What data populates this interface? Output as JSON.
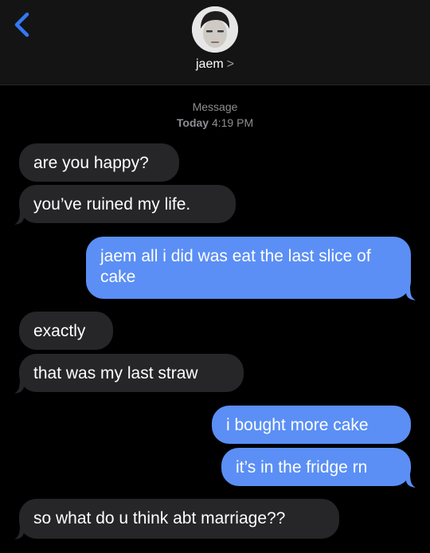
{
  "header": {
    "contact_name": "jaem",
    "chevron": ">",
    "back_icon": "chevron-left-icon",
    "avatar_icon": "contact-photo"
  },
  "thread": {
    "service_label": "Message",
    "date_label": "Today",
    "time_label": "4:19 PM"
  },
  "messages": [
    {
      "from": "them",
      "text": "are you happy?"
    },
    {
      "from": "them",
      "text": "you’ve ruined my life."
    },
    {
      "from": "me",
      "text": "jaem all i did was eat the last slice of cake"
    },
    {
      "from": "them",
      "text": "exactly"
    },
    {
      "from": "them",
      "text": "that was my last straw"
    },
    {
      "from": "me",
      "text": "i bought more cake"
    },
    {
      "from": "me",
      "text": "it’s in the fridge rn"
    },
    {
      "from": "them",
      "text": "so what do u think abt marriage??"
    }
  ],
  "colors": {
    "background": "#000000",
    "header": "#141414",
    "received_bubble": "#262628",
    "sent_bubble": "#5b8ff5",
    "accent": "#3478f6"
  }
}
